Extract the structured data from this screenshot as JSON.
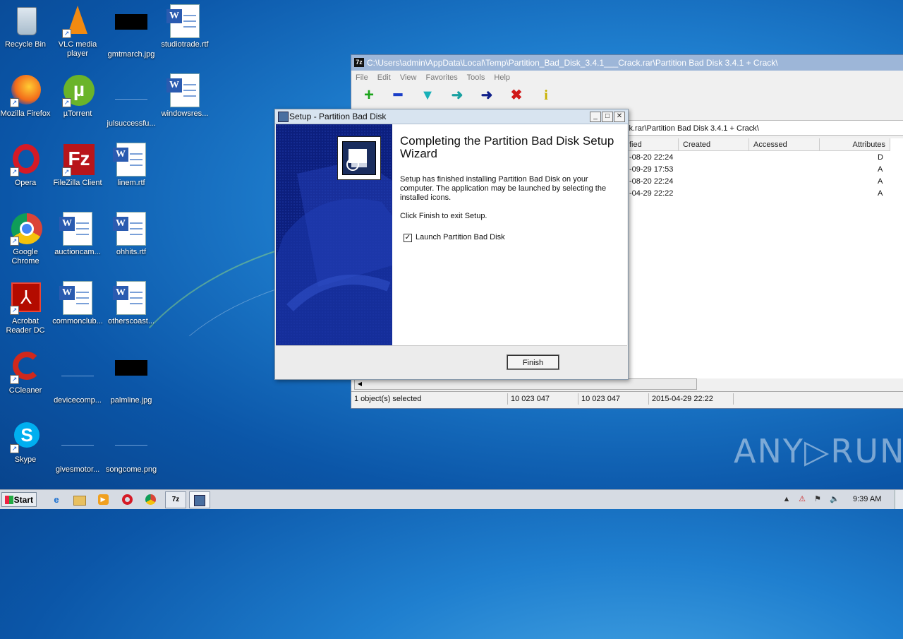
{
  "desktop": {
    "icons": [
      {
        "label": "Recycle Bin",
        "icon": "recycle-bin-icon"
      },
      {
        "label": "VLC media player",
        "icon": "vlc-icon"
      },
      {
        "label": "gmtmarch.jpg",
        "icon": "image-file-icon"
      },
      {
        "label": "studiotrade.rtf",
        "icon": "word-document-icon"
      },
      {
        "label": "Mozilla Firefox",
        "icon": "firefox-icon"
      },
      {
        "label": "µTorrent",
        "icon": "utorrent-icon"
      },
      {
        "label": "julsuccessfu...",
        "icon": "blank-file-icon"
      },
      {
        "label": "windowsres...",
        "icon": "word-document-icon"
      },
      {
        "label": "Opera",
        "icon": "opera-icon"
      },
      {
        "label": "FileZilla Client",
        "icon": "filezilla-icon"
      },
      {
        "label": "linem.rtf",
        "icon": "word-document-icon"
      },
      {
        "label": "Google Chrome",
        "icon": "chrome-icon"
      },
      {
        "label": "auctioncam...",
        "icon": "word-document-icon"
      },
      {
        "label": "ohhits.rtf",
        "icon": "word-document-icon"
      },
      {
        "label": "Acrobat Reader DC",
        "icon": "acrobat-icon"
      },
      {
        "label": "commonclub...",
        "icon": "word-document-icon"
      },
      {
        "label": "otherscoast...",
        "icon": "word-document-icon"
      },
      {
        "label": "CCleaner",
        "icon": "ccleaner-icon"
      },
      {
        "label": "devicecomp...",
        "icon": "blank-file-icon"
      },
      {
        "label": "palmline.jpg",
        "icon": "image-file-icon"
      },
      {
        "label": "Skype",
        "icon": "skype-icon"
      },
      {
        "label": "givesmotor...",
        "icon": "blank-file-icon"
      },
      {
        "label": "songcome.png",
        "icon": "blank-file-icon"
      }
    ]
  },
  "sevenzip": {
    "title": "C:\\Users\\admin\\AppData\\Local\\Temp\\Partition_Bad_Disk_3.4.1___Crack.rar\\Partition Bad Disk 3.4.1 + Crack\\",
    "app_icon_text": "7z",
    "menu": [
      "File",
      "Edit",
      "View",
      "Favorites",
      "Tools",
      "Help"
    ],
    "toolbar": [
      {
        "glyph": "+",
        "color": "#1aa31a",
        "label": "Add"
      },
      {
        "glyph": "━",
        "color": "#1a3ec8",
        "label": "Extract"
      },
      {
        "glyph": "▼",
        "color": "#18b0b8",
        "label": "Test"
      },
      {
        "glyph": "➜",
        "color": "#18a0a0",
        "label": "Copy"
      },
      {
        "glyph": "➜",
        "color": "#10208a",
        "label": "Move"
      },
      {
        "glyph": "✖",
        "color": "#d01818",
        "label": "Delete"
      },
      {
        "glyph": "i",
        "color": "#c8b000",
        "label": "Info"
      }
    ],
    "address": "ck.rar\\Partition Bad Disk 3.4.1 + Crack\\",
    "columns": [
      "fied",
      "Created",
      "Accessed",
      "Attributes"
    ],
    "rows": [
      {
        "modified": "-08-20 22:24",
        "attributes": "D"
      },
      {
        "modified": "-09-29 17:53",
        "attributes": "A"
      },
      {
        "modified": "-08-20 22:24",
        "attributes": "A"
      },
      {
        "modified": "-04-29 22:22",
        "attributes": "A"
      }
    ],
    "status": {
      "selected": "1 object(s) selected",
      "size": "10 023 047",
      "packed": "10 023 047",
      "date": "2015-04-29 22:22"
    }
  },
  "setup": {
    "title": "Setup - Partition Bad Disk",
    "heading": "Completing the Partition Bad Disk Setup Wizard",
    "body1": "Setup has finished installing Partition Bad Disk on your computer. The application may be launched by selecting the installed icons.",
    "body2": "Click Finish to exit Setup.",
    "checkbox_label": "Launch Partition Bad Disk",
    "checkbox_checked": true,
    "finish_label": "Finish"
  },
  "taskbar": {
    "start_label": "Start",
    "clock": "9:39 AM",
    "task_7zip": "7z"
  },
  "watermark": "ANY▷RUN"
}
